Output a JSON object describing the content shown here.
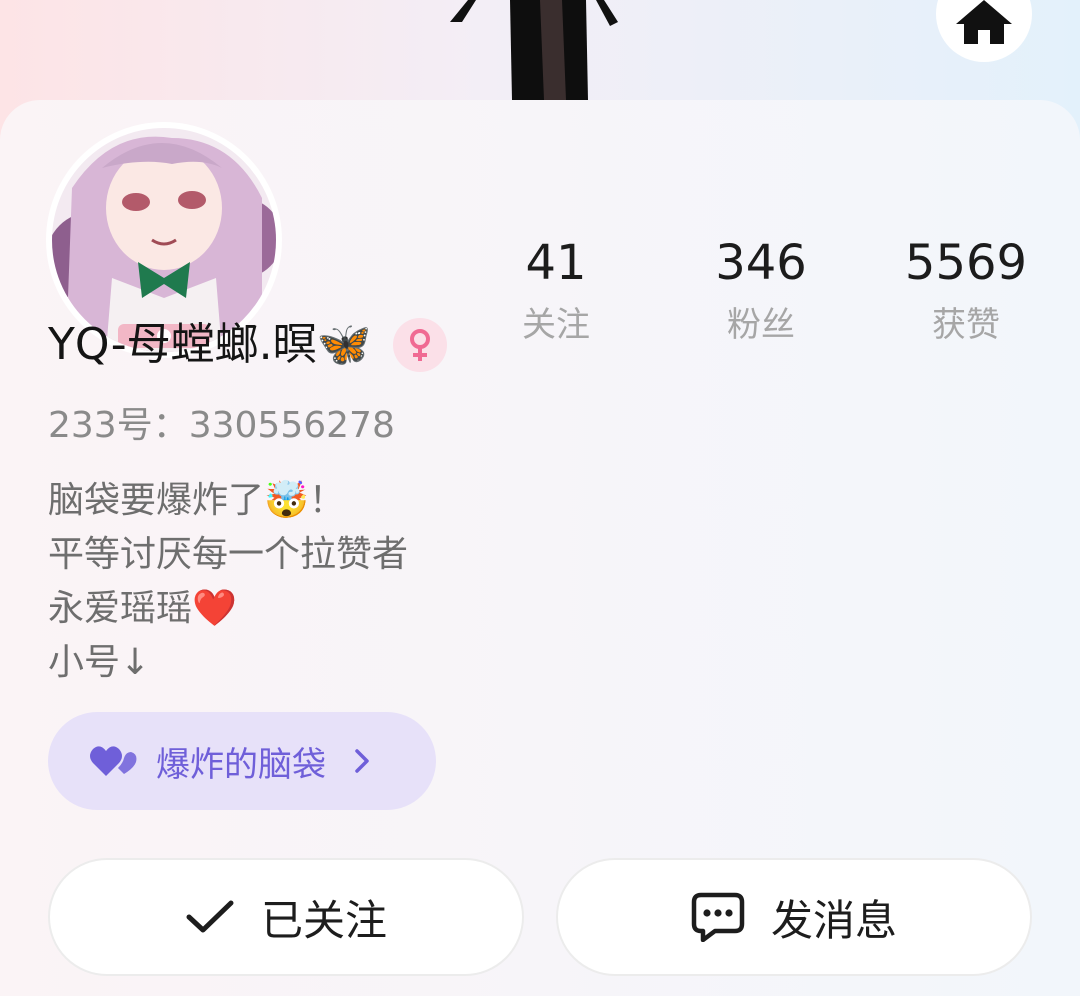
{
  "stats": [
    {
      "value": "41",
      "label": "关注"
    },
    {
      "value": "346",
      "label": "粉丝"
    },
    {
      "value": "5569",
      "label": "获赞"
    }
  ],
  "profile": {
    "name": "YQ-母螳螂.暝🦋",
    "uid": "233号：330556278",
    "bio": [
      "脑袋要爆炸了🤯！",
      "平等讨厌每一个拉赞者",
      "永爱瑶瑶❤️",
      "小号↓"
    ]
  },
  "group": {
    "label": "爆炸的脑袋"
  },
  "actions": {
    "follow_label": "已关注",
    "message_label": "发消息"
  },
  "colors": {
    "accent": "#6f5fd9",
    "chip_bg": "#e7e1f9",
    "gender": "#f06a93"
  }
}
